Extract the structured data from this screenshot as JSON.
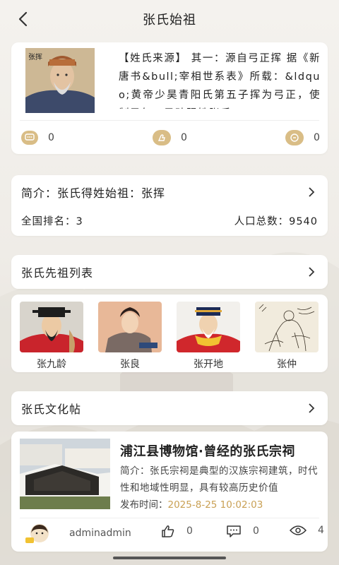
{
  "header": {
    "title": "张氏始祖",
    "back_icon": "back-arrow-icon"
  },
  "origin": {
    "text": "【姓氏来源】 其一：源自弓正挥 据《新唐书&bull;宰相世系表》所载：&ldquo;黄帝少昊青阳氏第五子挥为弓正，使制弓矢，子孙赐姓张氏。",
    "portrait_caption": "张挥",
    "comments": "0",
    "likes": "0",
    "shares": "0"
  },
  "intro": {
    "title": "简介：张氏得姓始祖：张挥",
    "rank": "全国排名：3",
    "population": "人口总数：9540"
  },
  "ancestor_section": {
    "title": "张氏先祖列表"
  },
  "ancestors": [
    {
      "name": "张九龄"
    },
    {
      "name": "张良"
    },
    {
      "name": "张开地"
    },
    {
      "name": "张仲"
    }
  ],
  "culture_section": {
    "title": "张氏文化帖"
  },
  "post": {
    "title": "浦江县博物馆·曾经的张氏宗祠",
    "summary": "简介：张氏宗祠是典型的汉族宗祠建筑，时代性和地域性明显，具有较高历史价值",
    "date_label": "发布时间：",
    "date": "2025-8-25 10:02:03",
    "author": "adminadmin",
    "likes": "0",
    "comments": "0",
    "views": "4"
  },
  "colors": {
    "accent": "#c9a054",
    "icon_bg": "#d9bd86"
  }
}
